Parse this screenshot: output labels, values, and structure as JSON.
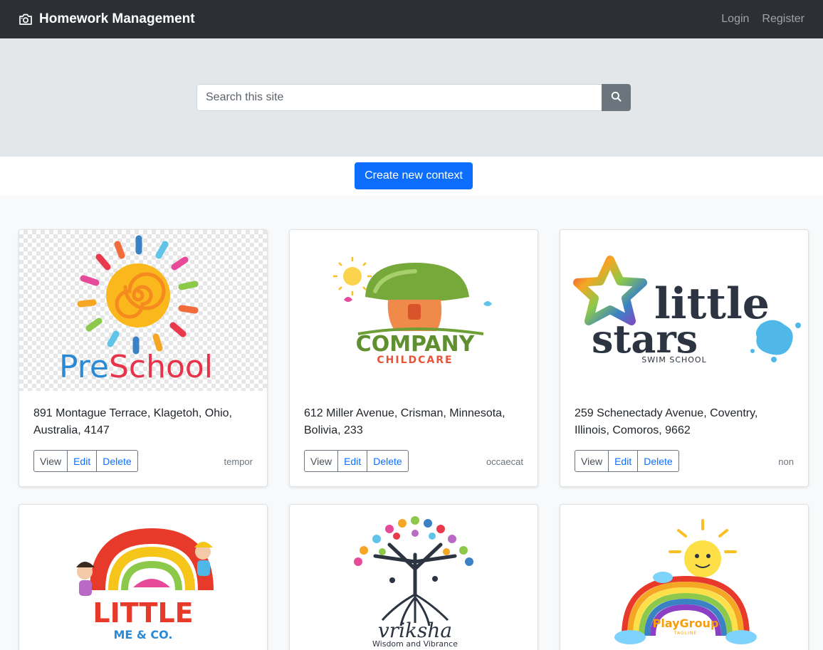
{
  "navbar": {
    "brand": "Homework Management",
    "brand_icon": "camera-icon",
    "links": [
      "Login",
      "Register"
    ]
  },
  "search": {
    "placeholder": "Search this site",
    "button_icon": "search-icon"
  },
  "create_button": "Create new context",
  "cards": [
    {
      "logo": "PreSchool",
      "address": "891 Montague Terrace, Klagetoh, Ohio, Australia, 4147",
      "tag": "tempor",
      "actions": [
        "View",
        "Edit",
        "Delete"
      ]
    },
    {
      "logo": "COMPANY CHILDCARE",
      "logo_line1": "COMPANY",
      "logo_line2": "CHILDCARE",
      "address": "612 Miller Avenue, Crisman, Minnesota, Bolivia, 233",
      "tag": "occaecat",
      "actions": [
        "View",
        "Edit",
        "Delete"
      ]
    },
    {
      "logo": "little stars SWIM SCHOOL",
      "logo_line1": "little",
      "logo_line2": "stars",
      "logo_line3": "SWIM SCHOOL",
      "address": "259 Schenectady Avenue, Coventry, Illinois, Comoros, 9662",
      "tag": "non",
      "actions": [
        "View",
        "Edit",
        "Delete"
      ]
    },
    {
      "logo_line1": "LITTLE",
      "logo_line2": "ME & CO."
    },
    {
      "logo_line1": "vriksha",
      "logo_line2": "Wisdom and Vibrance"
    },
    {
      "logo_line1": "PlayGroup",
      "logo_line2": "TAGLINE"
    }
  ],
  "colors": {
    "navbar": "#2c3035",
    "hero": "#e4e7ea",
    "primary": "#0d6efd",
    "search_button": "#6c757d"
  }
}
